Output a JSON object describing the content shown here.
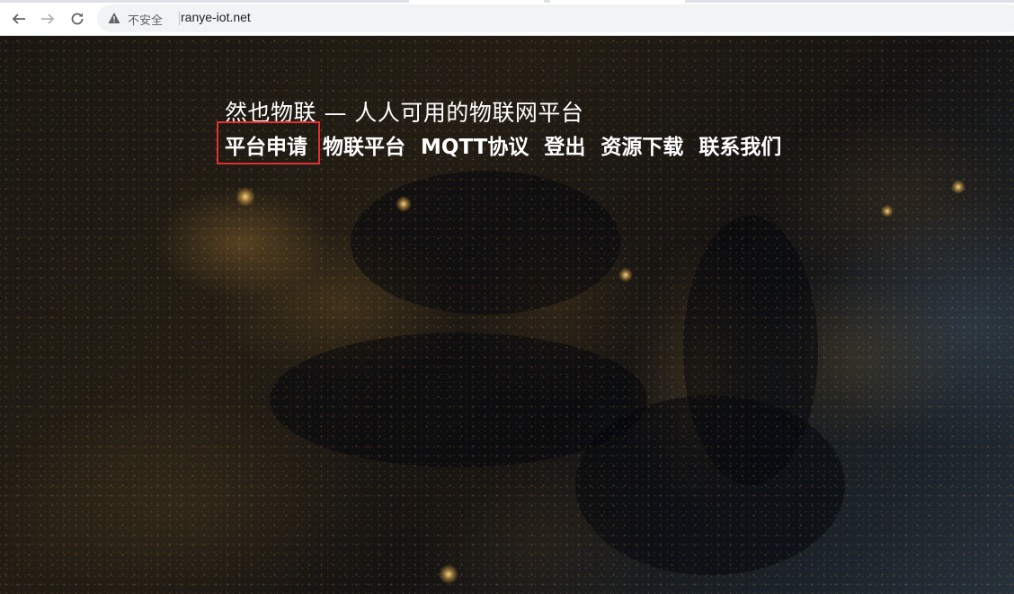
{
  "browser": {
    "security_label": "不安全",
    "url": "ranye-iot.net"
  },
  "site": {
    "title": "然也物联 — 人人可用的物联网平台"
  },
  "nav": {
    "items": [
      "平台申请",
      "物联平台",
      "MQTT协议",
      "登出",
      "资源下载",
      "联系我们"
    ],
    "highlighted_item": "平台申请"
  },
  "colors": {
    "highlight_border": "#e03030",
    "nav_text": "#ffffff"
  }
}
